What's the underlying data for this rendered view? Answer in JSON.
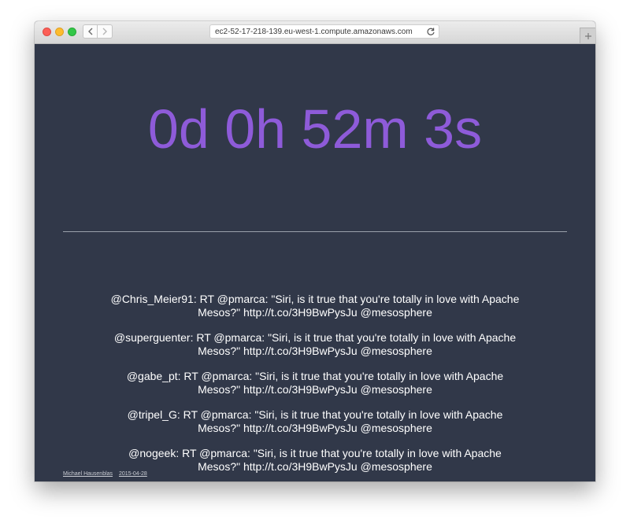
{
  "browser": {
    "url": "ec2-52-17-218-139.eu-west-1.compute.amazonaws.com",
    "back_icon": "chevron-left-icon",
    "forward_icon": "chevron-right-icon",
    "reload_icon": "reload-icon",
    "new_tab_icon": "plus-icon"
  },
  "colors": {
    "background": "#313849",
    "timer": "#8e5bd9",
    "text": "#ffffff"
  },
  "countdown": {
    "text": "0d 0h 52m 3s"
  },
  "tweets": [
    {
      "text": "@Chris_Meier91: RT @pmarca: \"Siri, is it true that you're totally in love with Apache Mesos?\" http://t.co/3H9BwPysJu @mesosphere"
    },
    {
      "text": "@superguenter: RT @pmarca: \"Siri, is it true that you're totally in love with Apache Mesos?\" http://t.co/3H9BwPysJu @mesosphere"
    },
    {
      "text": "@gabe_pt: RT @pmarca: \"Siri, is it true that you're totally in love with Apache Mesos?\" http://t.co/3H9BwPysJu @mesosphere"
    },
    {
      "text": "@tripel_G: RT @pmarca: \"Siri, is it true that you're totally in love with Apache Mesos?\" http://t.co/3H9BwPysJu @mesosphere"
    },
    {
      "text": "@nogeek: RT @pmarca: \"Siri, is it true that you're totally in love with Apache Mesos?\" http://t.co/3H9BwPysJu @mesosphere"
    }
  ],
  "footer": {
    "author": "Michael Hausenblas",
    "date": "2015-04-28"
  }
}
